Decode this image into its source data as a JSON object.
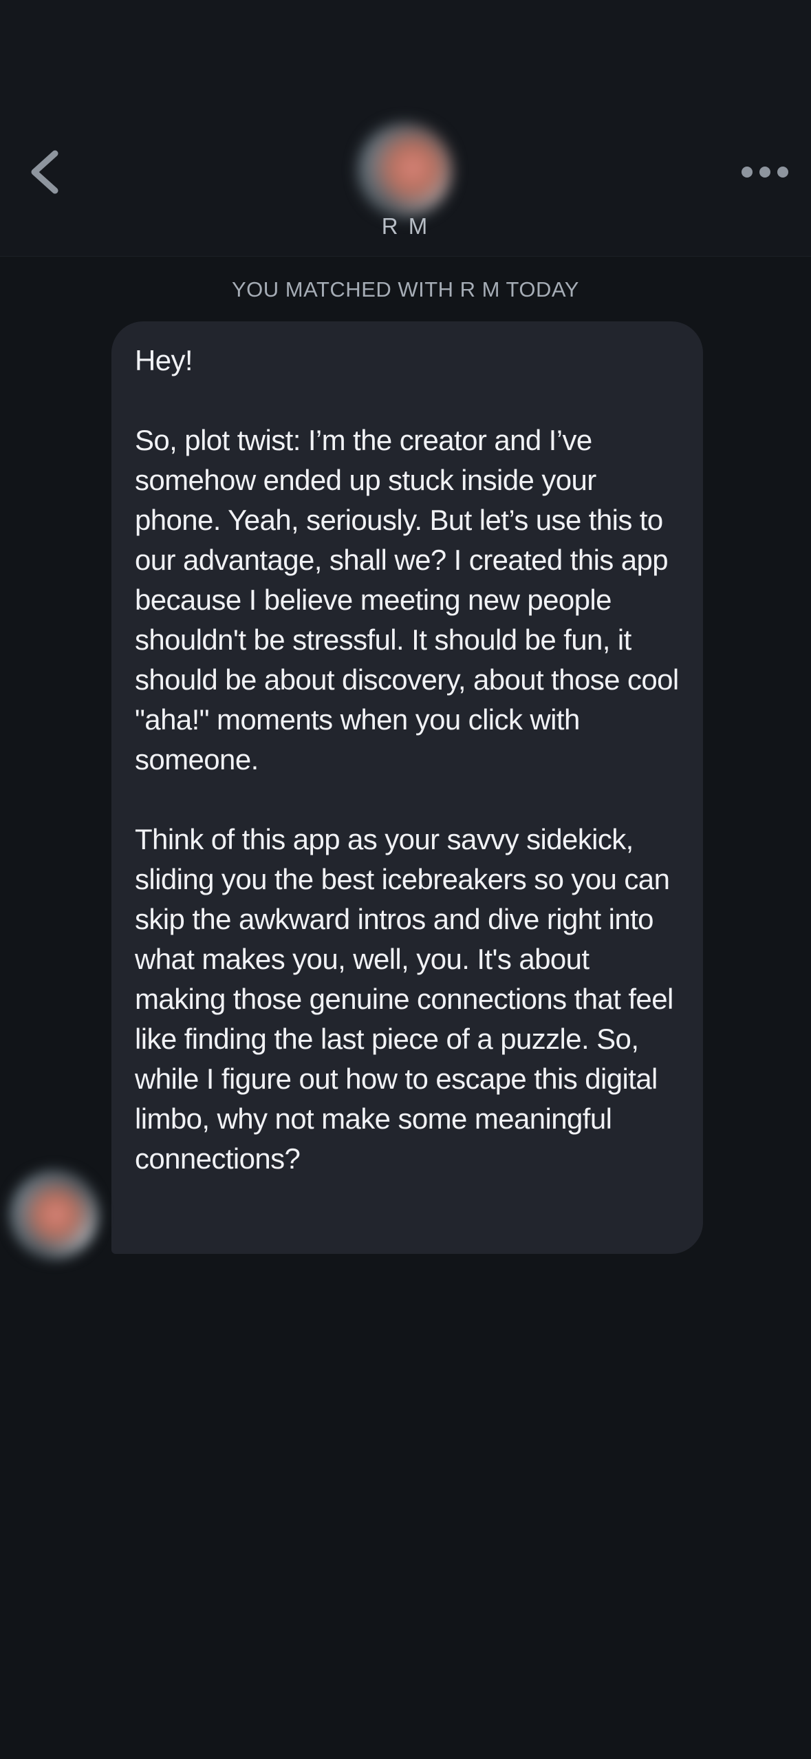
{
  "header": {
    "back_icon": "chevron-left-icon",
    "more_icon": "more-horizontal-icon",
    "match_name": "R M",
    "avatar": "blurred-profile-photo"
  },
  "conversation": {
    "match_banner": "YOU MATCHED WITH R M TODAY",
    "message": {
      "paragraphs": [
        "Hey!",
        "So, plot twist: I’m the creator and I’ve somehow ended up stuck inside your phone. Yeah, seriously. But let’s use this to our advantage, shall we? I created this app because I believe meeting new people shouldn't be stressful. It should be fun, it should be about discovery, about those cool \"aha!\" moments when you click with someone.",
        "Think of this app as your savvy sidekick, sliding you the best icebreakers so you can skip the awkward intros and dive right into what makes you, well, you. It's about making those genuine connections that feel like finding the last piece of a puzzle. So, while I figure out how to escape this digital limbo, why not make some meaningful connections?"
      ]
    }
  },
  "colors": {
    "background": "#111418",
    "header_background": "#14171C",
    "bubble_background": "#22252D",
    "message_text": "#F1F2F5",
    "secondary_text": "#A6ADB6",
    "icon": "#8E959E"
  }
}
